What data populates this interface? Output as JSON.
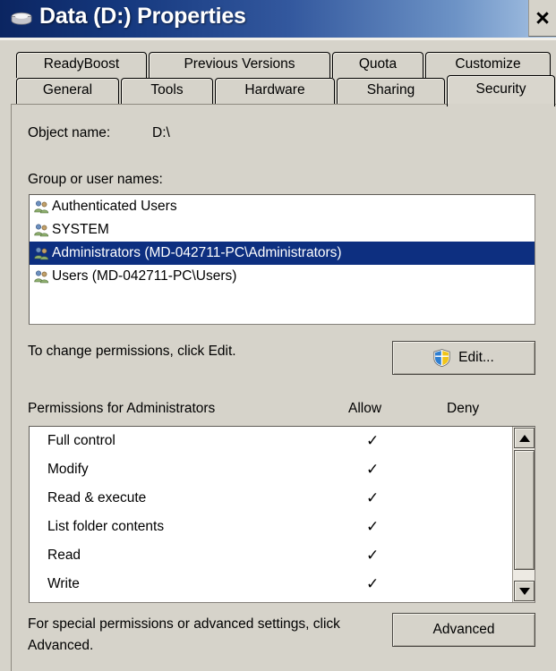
{
  "window": {
    "title": "Data (D:) Properties",
    "icon": "hard-drive-icon",
    "close_label": "×",
    "titlebar_gradient_start": "#0b2561",
    "titlebar_gradient_end": "#a8c4e4",
    "dialog_background": "#d6d3ca"
  },
  "tabs": {
    "row1": [
      {
        "label": "ReadyBoost",
        "selected": false
      },
      {
        "label": "Previous Versions",
        "selected": false
      },
      {
        "label": "Quota",
        "selected": false
      },
      {
        "label": "Customize",
        "selected": false
      }
    ],
    "row2": [
      {
        "label": "General",
        "selected": false
      },
      {
        "label": "Tools",
        "selected": false
      },
      {
        "label": "Hardware",
        "selected": false
      },
      {
        "label": "Sharing",
        "selected": false
      },
      {
        "label": "Security",
        "selected": true
      }
    ]
  },
  "security": {
    "object_name_label": "Object name:",
    "object_name_value": "D:\\",
    "group_list_label": "Group or user names:",
    "groups": [
      {
        "name": "Authenticated Users",
        "selected": false
      },
      {
        "name": "SYSTEM",
        "selected": false
      },
      {
        "name": "Administrators (MD-042711-PC\\Administrators)",
        "selected": true
      },
      {
        "name": "Users (MD-042711-PC\\Users)",
        "selected": false
      }
    ],
    "edit_hint": "To change permissions, click Edit.",
    "edit_button": "Edit...",
    "edit_button_icon": "uac-shield-icon",
    "permissions_label": "Permissions for Administrators",
    "column_allow": "Allow",
    "column_deny": "Deny",
    "check_glyph": "✓",
    "permissions": [
      {
        "name": "Full control",
        "allow": true,
        "deny": false
      },
      {
        "name": "Modify",
        "allow": true,
        "deny": false
      },
      {
        "name": "Read & execute",
        "allow": true,
        "deny": false
      },
      {
        "name": "List folder contents",
        "allow": true,
        "deny": false
      },
      {
        "name": "Read",
        "allow": true,
        "deny": false
      },
      {
        "name": "Write",
        "allow": true,
        "deny": false
      }
    ],
    "footer_hint": "For special permissions or advanced settings, click Advanced.",
    "advanced_button": "Advanced",
    "selection_color": "#0d2f80"
  }
}
